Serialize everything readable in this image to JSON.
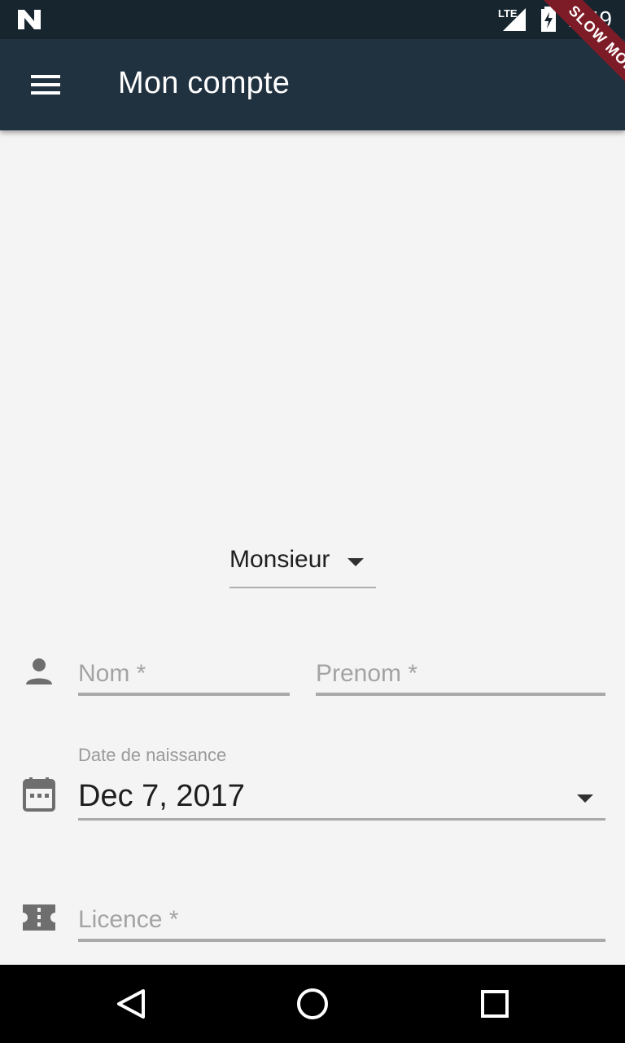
{
  "status": {
    "time": "1:49",
    "network": "LTE",
    "banner": "SLOW MODE"
  },
  "appbar": {
    "title": "Mon compte",
    "menu_icon": "menu-icon"
  },
  "form": {
    "civility": {
      "value": "Monsieur"
    },
    "nom": {
      "placeholder": "Nom *"
    },
    "prenom": {
      "placeholder": "Prenom *"
    },
    "birthdate": {
      "label": "Date de naissance",
      "value": "Dec 7, 2017"
    },
    "licence": {
      "placeholder": "Licence *"
    }
  },
  "colors": {
    "appbar": "#203140",
    "statusbar": "#17252f",
    "background": "#f4f4f4",
    "banner": "#7d1c27"
  }
}
